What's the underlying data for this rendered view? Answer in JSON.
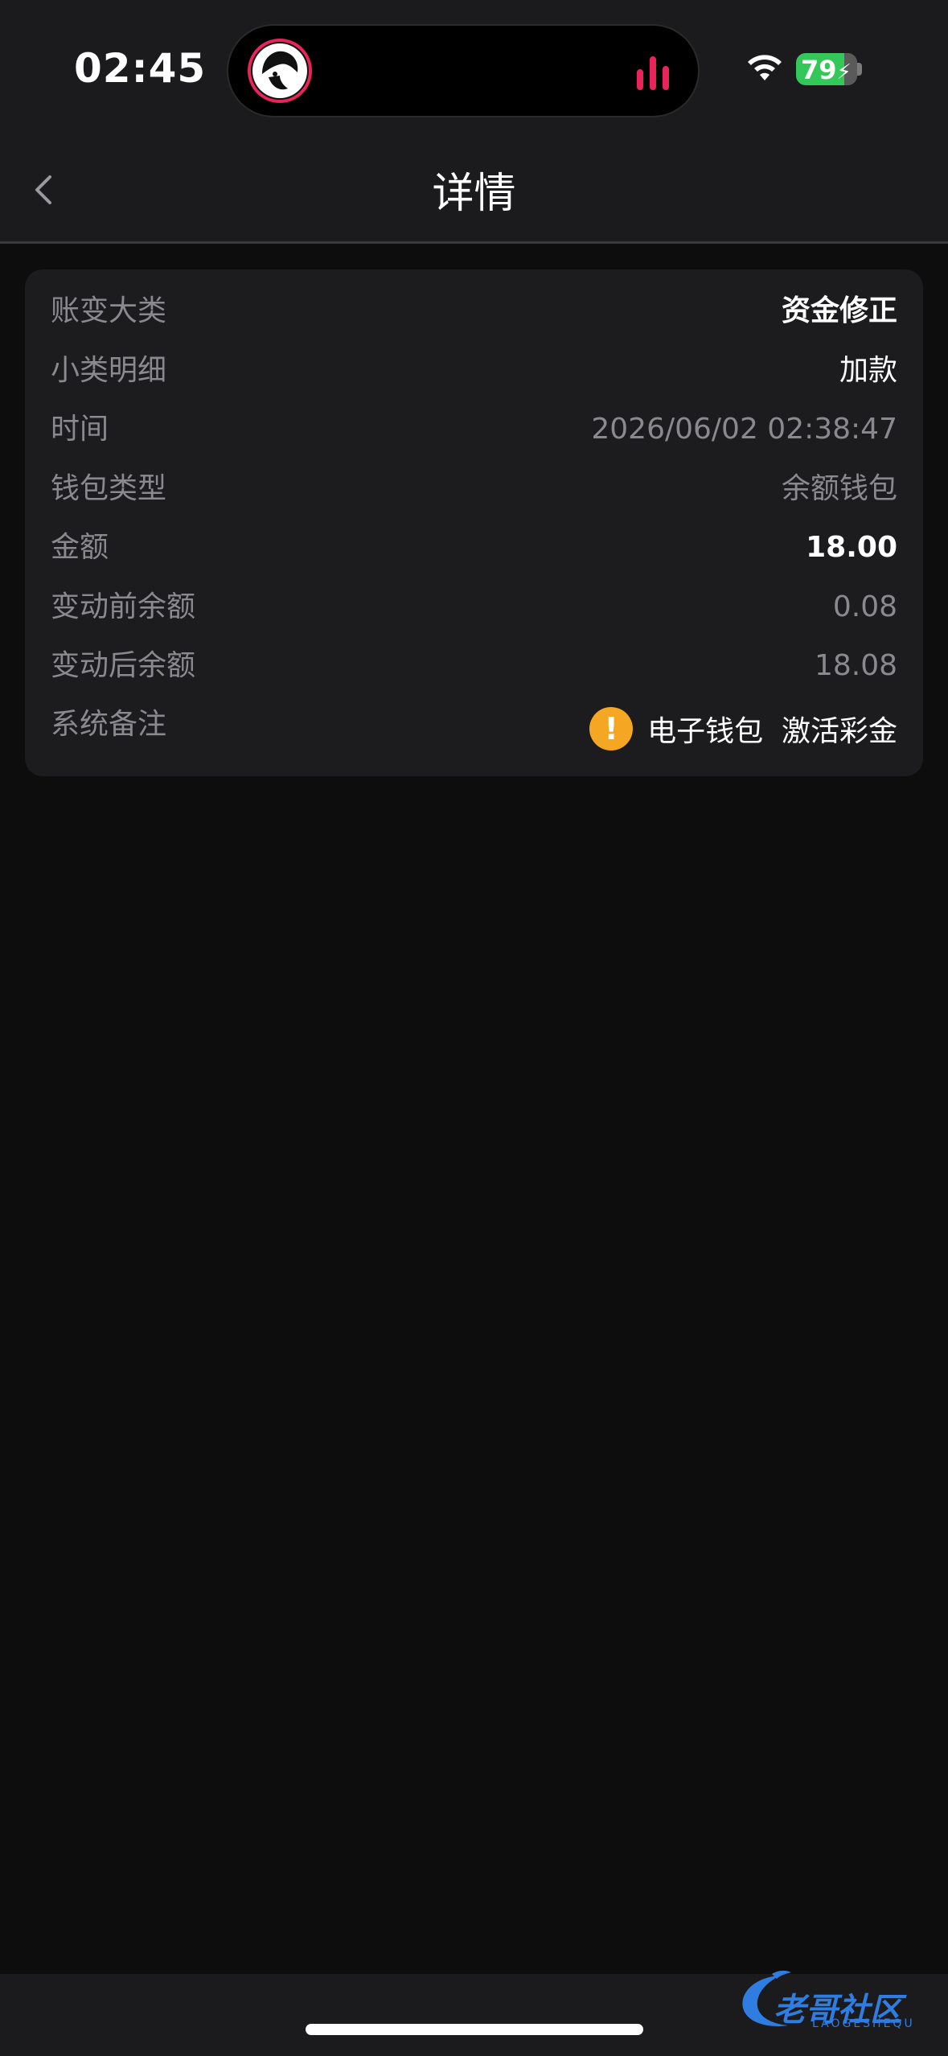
{
  "status_bar": {
    "time": "02:45",
    "battery": "79"
  },
  "nav": {
    "title": "详情"
  },
  "details": [
    {
      "label": "账变大类",
      "value": "资金修正"
    },
    {
      "label": "小类明细",
      "value": "加款"
    },
    {
      "label": "时间",
      "value": "2026/06/02 02:38:47"
    },
    {
      "label": "钱包类型",
      "value": "余额钱包"
    },
    {
      "label": "金额",
      "value": "18.00"
    },
    {
      "label": "变动前余额",
      "value": "0.08"
    },
    {
      "label": "变动后余额",
      "value": "18.08"
    },
    {
      "label": "系统备注",
      "value": "电子钱包  激活彩金"
    }
  ],
  "remark_icon": "exclamation-icon",
  "watermark": {
    "text": "老哥社区",
    "sub": "LAOGESHEQU"
  },
  "colors": {
    "background": "#0d0d0d",
    "card": "#1c1c1e",
    "label": "#8a8a8e",
    "warning": "#f5a623",
    "battery": "#34c759",
    "accent": "#e8245a"
  }
}
